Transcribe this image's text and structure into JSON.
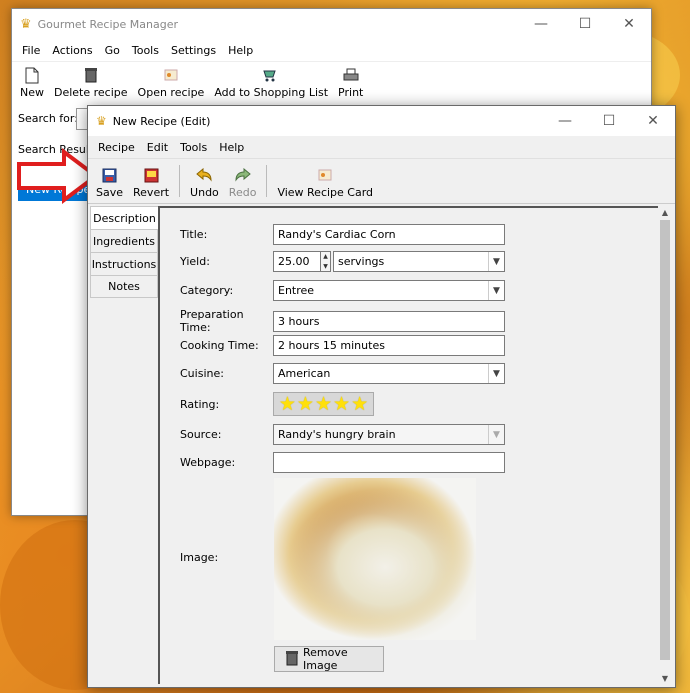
{
  "colors": {
    "accent_red": "#e01e1e",
    "star": "#ffe00a"
  },
  "back_window": {
    "title": "Gourmet Recipe Manager",
    "menu": [
      "File",
      "Actions",
      "Go",
      "Tools",
      "Settings",
      "Help"
    ],
    "toolbar": [
      {
        "label": "New",
        "icon": "new-document-icon"
      },
      {
        "label": "Delete recipe",
        "icon": "trash-icon"
      },
      {
        "label": "Open recipe",
        "icon": "recipe-card-icon"
      },
      {
        "label": "Add to Shopping List",
        "icon": "shopping-icon"
      },
      {
        "label": "Print",
        "icon": "printer-icon"
      }
    ],
    "search_label": "Search for:",
    "search_results_label": "Search Results",
    "list_item_partial": "New Recipe"
  },
  "front_window": {
    "title": "New Recipe (Edit)",
    "menu": [
      "Recipe",
      "Edit",
      "Tools",
      "Help"
    ],
    "toolbar": {
      "save": "Save",
      "revert": "Revert",
      "undo": "Undo",
      "redo": "Redo",
      "view_card": "View Recipe Card"
    },
    "tabs": [
      "Description",
      "Ingredients",
      "Instructions",
      "Notes"
    ],
    "form": {
      "title_label": "Title:",
      "title_value": "Randy's Cardiac Corn",
      "yield_label": "Yield:",
      "yield_value": "25.00",
      "yield_unit": "servings",
      "category_label": "Category:",
      "category_value": "Entree",
      "prep_label": "Preparation Time:",
      "prep_value": "3 hours",
      "cook_label": "Cooking Time:",
      "cook_value": "2 hours 15 minutes",
      "cuisine_label": "Cuisine:",
      "cuisine_value": "American",
      "rating_label": "Rating:",
      "rating_value": 5,
      "rating_max": 5,
      "source_label": "Source:",
      "source_value": "Randy's hungry brain",
      "webpage_label": "Webpage:",
      "webpage_value": "",
      "image_label": "Image:",
      "remove_image": "Remove Image"
    }
  }
}
